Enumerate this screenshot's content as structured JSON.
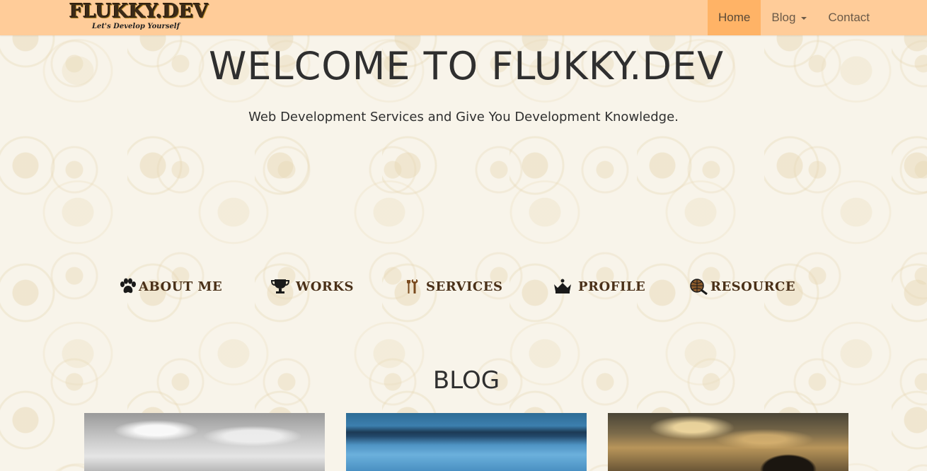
{
  "brand": {
    "title": "FLUKKY.DEV",
    "tagline": "Let's Develop Yourself"
  },
  "nav": {
    "items": [
      {
        "label": "Home",
        "active": true
      },
      {
        "label": "Blog",
        "dropdown": true
      },
      {
        "label": "Contact"
      }
    ]
  },
  "hero": {
    "title": "WELCOME TO FLUKKY.DEV",
    "subtitle": "Web Development Services and Give You Development Knowledge."
  },
  "sections": [
    {
      "label": "ABOUT ME",
      "icon": "paw-icon"
    },
    {
      "label": "WORKS",
      "icon": "trophy-icon"
    },
    {
      "label": "SERVICES",
      "icon": "tools-icon"
    },
    {
      "label": "PROFILE",
      "icon": "crown-icon"
    },
    {
      "label": "RESOURCE",
      "icon": "globe-search-icon"
    }
  ],
  "blog": {
    "heading": "BLOG"
  },
  "colors": {
    "navbar": "#ffcc99",
    "nav_active": "#ffb366",
    "text": "#2f2f2f",
    "section_label": "#4a3018"
  }
}
